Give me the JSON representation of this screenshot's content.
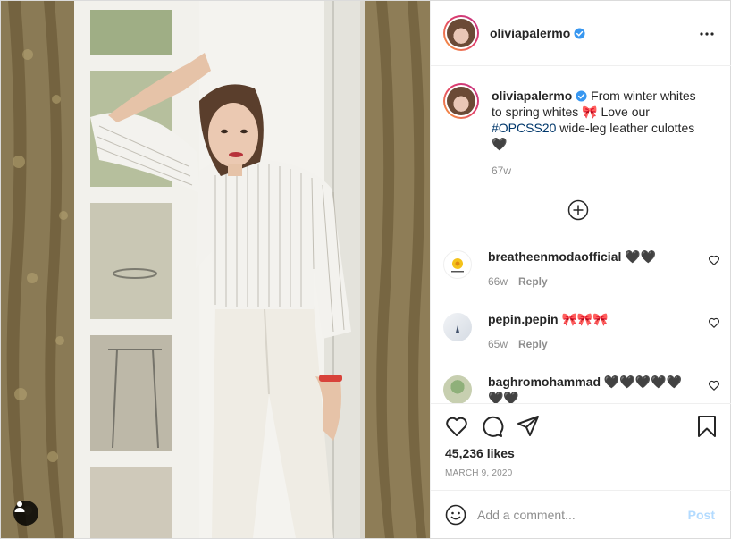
{
  "post": {
    "username": "oliviapalermo",
    "caption_text": " From winter whites to spring whites 🎀 Love our ",
    "caption_hashtag": "#OPCSS20",
    "caption_text_end": " wide-leg leather culottes 🖤",
    "caption_time": "67w",
    "likes": "45,236 likes",
    "date": "MARCH 9, 2020"
  },
  "comments": [
    {
      "username": "breatheenmodaofficial",
      "text": " 🖤🖤",
      "time": "66w",
      "reply": "Reply"
    },
    {
      "username": "pepin.pepin",
      "text": " 🎀🎀🎀",
      "time": "65w",
      "reply": "Reply"
    },
    {
      "username": "baghromohammad",
      "text": " 🖤🖤🖤🖤🖤🖤🖤",
      "time": "",
      "reply": ""
    }
  ],
  "add_comment": {
    "placeholder": "Add a comment...",
    "post_label": "Post"
  },
  "colors": {
    "verified": "#3897f0",
    "link": "#00376b",
    "post_disabled": "#b3dbff"
  },
  "icons": [
    "verified-badge-icon",
    "more-options-icon",
    "load-more-icon",
    "heart-icon",
    "comment-icon",
    "share-icon",
    "save-icon",
    "emoji-icon",
    "user-tag-icon"
  ]
}
